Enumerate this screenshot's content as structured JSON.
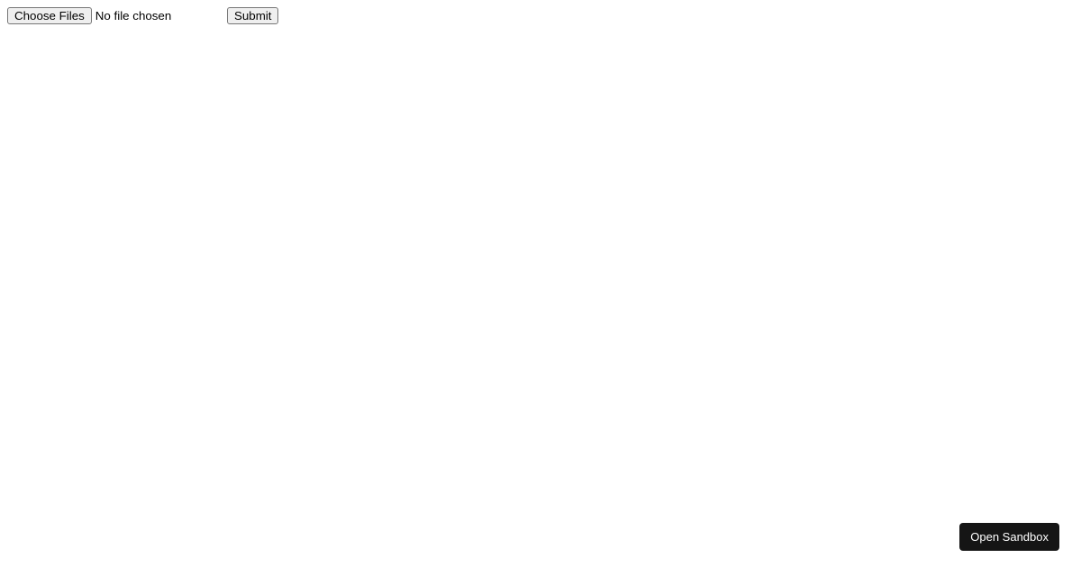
{
  "form": {
    "file_input": {
      "button_label": "Choose Files",
      "status_text": "No file chosen"
    },
    "submit_label": "Submit"
  },
  "sandbox": {
    "open_label": "Open Sandbox"
  }
}
